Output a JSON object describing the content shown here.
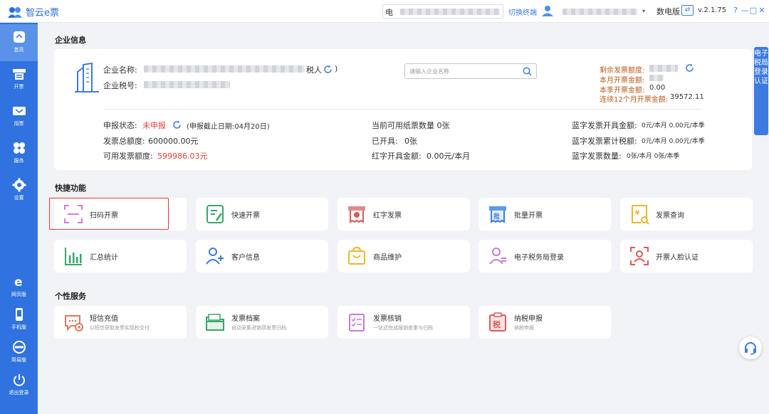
{
  "app": {
    "title": "智云e票",
    "terminal_label": "电",
    "switch_terminal": "切换终端",
    "dropdown_caret": "▾",
    "edition": "数电版",
    "edition_switch": "⇄",
    "version": "v.2.1.75",
    "window_buttons": [
      "?",
      "—",
      "□",
      "✕"
    ]
  },
  "sidebar": {
    "items": [
      {
        "label": "首页",
        "icon": "home-icon",
        "active": true
      },
      {
        "label": "开票",
        "icon": "invoice-printer-icon"
      },
      {
        "label": "用票",
        "icon": "ticket-icon"
      },
      {
        "label": "服务",
        "icon": "service-grid-icon"
      },
      {
        "label": "设置",
        "icon": "gear-icon"
      }
    ],
    "bottom_items": [
      {
        "label": "网页版",
        "icon": "web-browser-icon"
      },
      {
        "label": "手机版",
        "icon": "mobile-phone-icon"
      },
      {
        "label": "简易版",
        "icon": "simple-edition-icon"
      },
      {
        "label": "退出登录",
        "icon": "power-icon"
      }
    ]
  },
  "company": {
    "section_title": "企业信息",
    "name_label": "企业名称:",
    "name_suffix": "税人",
    "name_close": ")",
    "tax_label": "企业税号:",
    "search_placeholder": "请输入企业名称",
    "remaining_quota_label": "剩余发票额度:",
    "month_amount_label": "本月开票金额:",
    "quarter_amount_label": "本季开票金额:",
    "quarter_amount_value": "0.00",
    "twelve_month_label": "连续12个月开票金额:",
    "twelve_month_value": "39572.11",
    "declare_status_label": "申报状态:",
    "declare_status_value": "未申报",
    "declare_deadline": "(申报截止日期:04月20日)",
    "total_quota_label": "发票总额度:",
    "total_quota_value": "600000.00元",
    "available_quota_label": "可用发票额度:",
    "available_quota_value": "599986.03元",
    "paper_count": "当前可用纸票数量 0张",
    "issued_label": "已开具:",
    "issued_value": "0张",
    "red_amount_label": "红字开具金额:",
    "red_amount_value": "0.00元/本月",
    "blue_amount_label": "蓝字发票开具金额:",
    "blue_amount_value": "0元/本月 0.00元/本季",
    "blue_tax_label": "蓝字发票累计税额:",
    "blue_tax_value": "0元/本月 0.00元/本季",
    "blue_count_label": "蓝字发票数量:",
    "blue_count_value": "0张/本月 0张/本季"
  },
  "quick": {
    "section_title": "快捷功能",
    "items": [
      {
        "label": "扫码开票",
        "icon": "scan-qr-icon"
      },
      {
        "label": "快速开票",
        "icon": "quick-invoice-icon"
      },
      {
        "label": "红字发票",
        "icon": "red-invoice-icon"
      },
      {
        "label": "批量开票",
        "icon": "batch-invoice-icon"
      },
      {
        "label": "发票查询",
        "icon": "invoice-search-icon"
      },
      {
        "label": "汇总统计",
        "icon": "bar-chart-icon"
      },
      {
        "label": "客户信息",
        "icon": "add-customer-icon"
      },
      {
        "label": "商品维护",
        "icon": "goods-maintain-icon"
      },
      {
        "label": "电子税务局登录",
        "icon": "tax-bureau-login-icon"
      },
      {
        "label": "开票人脸认证",
        "icon": "face-auth-icon"
      }
    ]
  },
  "personal": {
    "section_title": "个性服务",
    "items": [
      {
        "label": "短信充值",
        "sub": "以短信获取发票实现秒交付",
        "icon": "sms-recharge-icon"
      },
      {
        "label": "发票档案",
        "sub": "自动采集进销项发票归档",
        "icon": "invoice-archive-icon"
      },
      {
        "label": "发票核销",
        "sub": "一站式完成报销查重与归档",
        "icon": "invoice-writeoff-icon"
      },
      {
        "label": "纳税申报",
        "sub": "纳税申报",
        "icon": "tax-declare-icon"
      }
    ]
  },
  "right_tab": "电子税局登录认证",
  "colors": {
    "primary": "#2f72e0",
    "red": "#e8413a",
    "brown": "#b85c1f"
  }
}
